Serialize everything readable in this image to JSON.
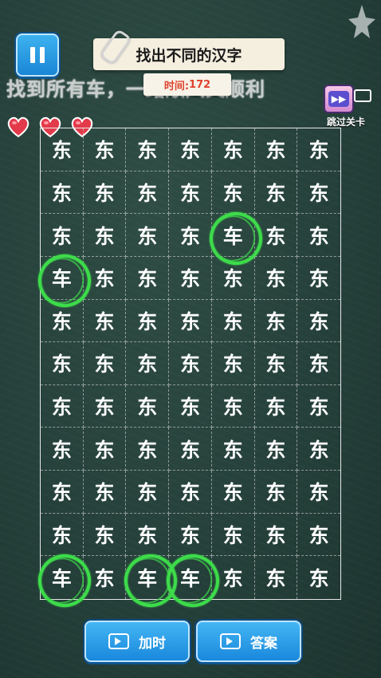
{
  "header": {
    "title": "找出不同的汉字",
    "banner": "找到所有车，一路顺风又顺利",
    "timer_label": "时间:",
    "timer_value": "172",
    "skip_label": "跳过关卡"
  },
  "lives": {
    "count": 3
  },
  "grid": {
    "columns": 7,
    "rows": 11,
    "base_char": "东",
    "cells": [
      [
        "东",
        "东",
        "东",
        "东",
        "东",
        "东",
        "东"
      ],
      [
        "东",
        "东",
        "东",
        "东",
        "东",
        "东",
        "东"
      ],
      [
        "东",
        "东",
        "东",
        "东",
        "车",
        "东",
        "东"
      ],
      [
        "车",
        "东",
        "东",
        "东",
        "东",
        "东",
        "东"
      ],
      [
        "东",
        "东",
        "东",
        "东",
        "东",
        "东",
        "东"
      ],
      [
        "东",
        "东",
        "东",
        "东",
        "东",
        "东",
        "东"
      ],
      [
        "东",
        "东",
        "东",
        "东",
        "东",
        "东",
        "东"
      ],
      [
        "东",
        "东",
        "东",
        "东",
        "东",
        "东",
        "东"
      ],
      [
        "东",
        "东",
        "东",
        "东",
        "东",
        "东",
        "东"
      ],
      [
        "东",
        "东",
        "东",
        "东",
        "东",
        "东",
        "东"
      ],
      [
        "车",
        "东",
        "车",
        "车",
        "东",
        "东",
        "东"
      ]
    ],
    "found": [
      [
        2,
        4
      ],
      [
        3,
        0
      ],
      [
        10,
        0
      ],
      [
        10,
        2
      ],
      [
        10,
        3
      ]
    ]
  },
  "buttons": {
    "add_time": "加时",
    "answer": "答案"
  },
  "colors": {
    "board": "#25403a",
    "ring": "#3ddc4a",
    "button": "#1a88dc",
    "timer_text": "#e0432f",
    "heart": "#e23a4a"
  }
}
